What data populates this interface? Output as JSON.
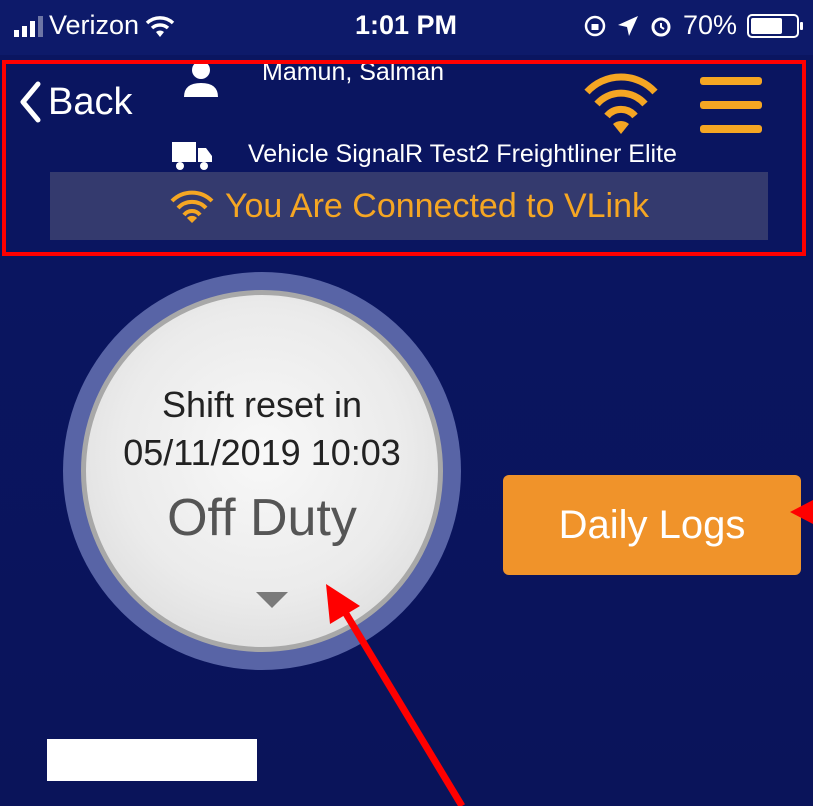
{
  "status_bar": {
    "carrier": "Verizon",
    "time": "1:01 PM",
    "battery_percent": "70%",
    "battery_level": 0.7
  },
  "header": {
    "back_label": "Back",
    "driver_name": "Mamun, Salman",
    "vehicle_name": "Vehicle SignalR Test2 Freightliner Elite",
    "connection_status": "You Are Connected to VLink"
  },
  "duty": {
    "shift_label": "Shift reset in",
    "shift_time": "05/11/2019 10:03",
    "status": "Off Duty"
  },
  "actions": {
    "daily_logs_label": "Daily Logs"
  },
  "colors": {
    "background": "#0a1560",
    "accent": "#f5a623",
    "button": "#f0932a",
    "annotation": "#ff0000"
  },
  "icons": [
    "signal-bars-icon",
    "wifi-icon",
    "lock-rotation-icon",
    "location-arrow-icon",
    "alarm-icon",
    "battery-icon",
    "back-chevron-icon",
    "user-icon",
    "truck-icon",
    "vlink-wifi-icon",
    "menu-icon",
    "dropdown-arrow-icon"
  ]
}
